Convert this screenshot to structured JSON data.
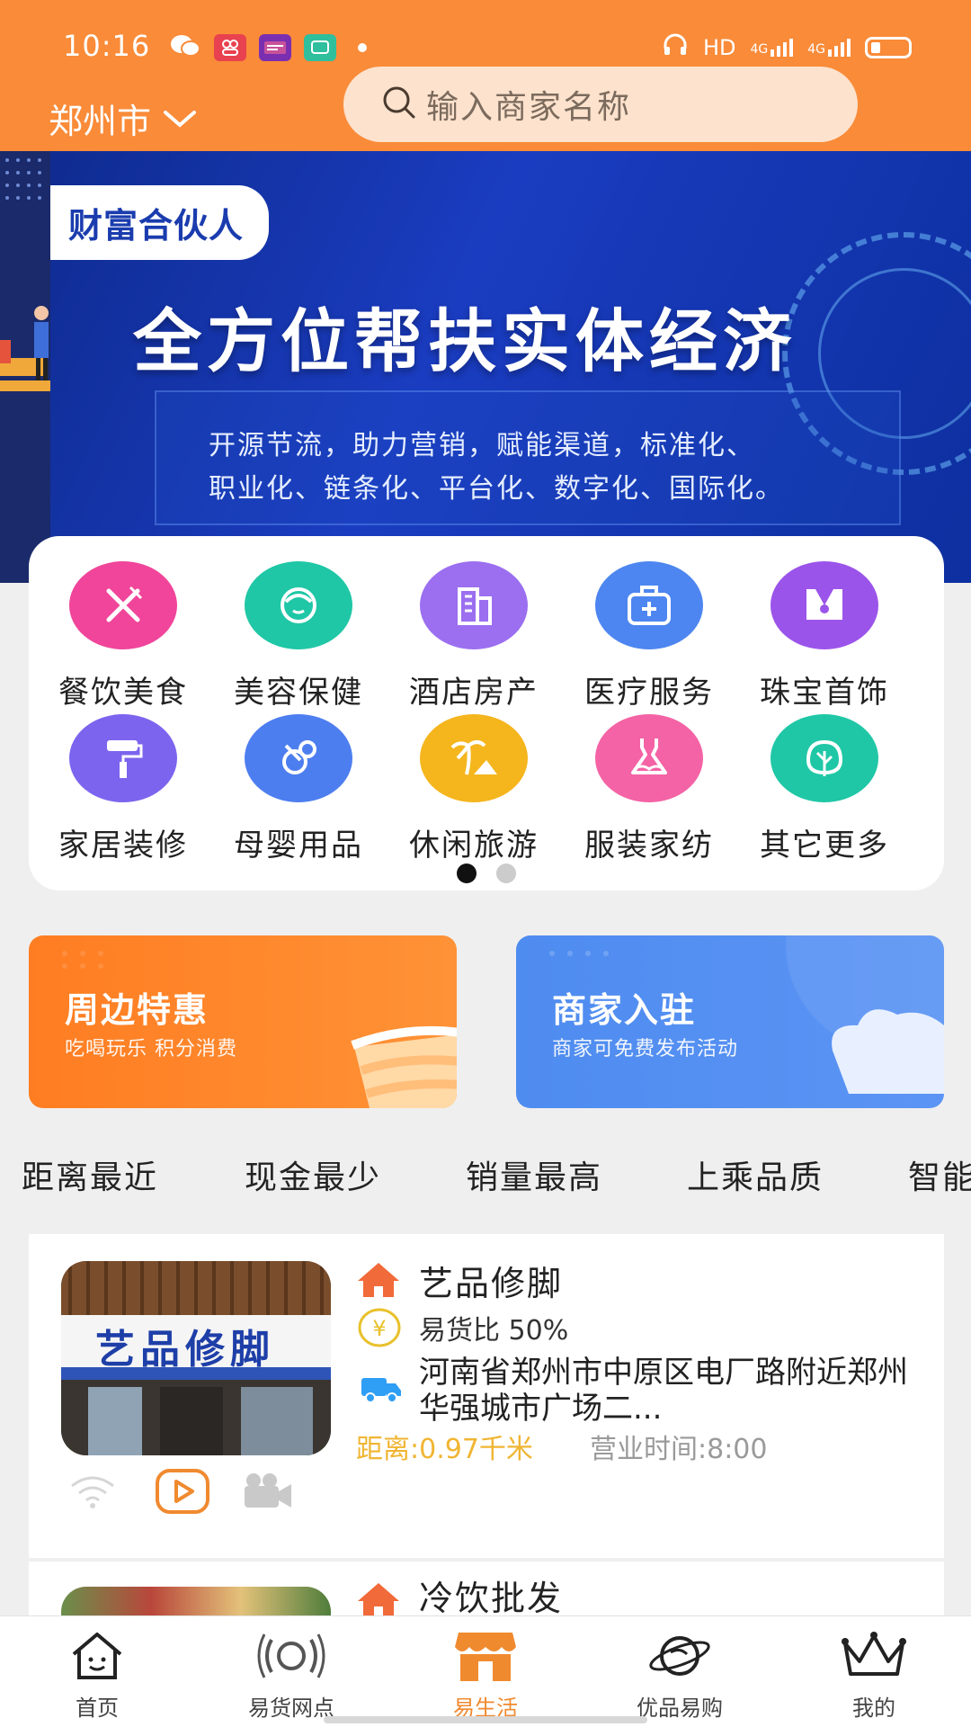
{
  "status": {
    "time": "10:16",
    "network": "HD",
    "signal1": "4G",
    "signal2": "4G",
    "apps": [
      "wechat-icon",
      "people-icon",
      "bank-icon",
      "message-icon"
    ]
  },
  "header": {
    "city": "郑州市",
    "search_placeholder": "输入商家名称"
  },
  "banner": {
    "tag": "财富合伙人",
    "title": "全方位帮扶实体经济",
    "line1": "开源节流，助力营销，赋能渠道，标准化、",
    "line2": "职业化、链条化、平台化、数字化、国际化。"
  },
  "categories": [
    {
      "label": "餐饮美食",
      "icon": "dining-icon",
      "color": "#f0459a"
    },
    {
      "label": "美容保健",
      "icon": "beauty-icon",
      "color": "#1fc7a6"
    },
    {
      "label": "酒店房产",
      "icon": "building-icon",
      "color": "#9b6ff0"
    },
    {
      "label": "医疗服务",
      "icon": "medical-kit-icon",
      "color": "#4d86f0"
    },
    {
      "label": "珠宝首饰",
      "icon": "necklace-icon",
      "color": "#9b54ea"
    },
    {
      "label": "家居装修",
      "icon": "paint-roller-icon",
      "color": "#7d64ee"
    },
    {
      "label": "母婴用品",
      "icon": "pacifier-icon",
      "color": "#4d7ef0"
    },
    {
      "label": "休闲旅游",
      "icon": "palm-tree-icon",
      "color": "#f5b51d"
    },
    {
      "label": "服装家纺",
      "icon": "dress-icon",
      "color": "#f463a5"
    },
    {
      "label": "其它更多",
      "icon": "leaf-icon",
      "color": "#1fc7a6"
    }
  ],
  "promos": [
    {
      "title": "周边特惠",
      "subtitle": "吃喝玩乐 积分消费"
    },
    {
      "title": "商家入驻",
      "subtitle": "商家可免费发布活动"
    }
  ],
  "filters": [
    "距离最近",
    "现金最少",
    "销量最高",
    "上乘品质",
    "智能"
  ],
  "stores": [
    {
      "name": "艺品修脚",
      "sign": "艺品修脚",
      "ratio": "易货比 50%",
      "address": "河南省郑州市中原区电厂路附近郑州华强城市广场二...",
      "distance": "距离:0.97千米",
      "hours": "营业时间:8:00"
    },
    {
      "name": "冷饮批发"
    }
  ],
  "nav": [
    {
      "label": "首页",
      "icon": "home-icon"
    },
    {
      "label": "易货网点",
      "icon": "signal-icon"
    },
    {
      "label": "易生活",
      "icon": "shop-icon",
      "active": true
    },
    {
      "label": "优品易购",
      "icon": "planet-icon"
    },
    {
      "label": "我的",
      "icon": "crown-icon"
    }
  ],
  "colors": {
    "header": "#f98b39",
    "accent": "#f08a2f",
    "distance": "#f0b533"
  }
}
